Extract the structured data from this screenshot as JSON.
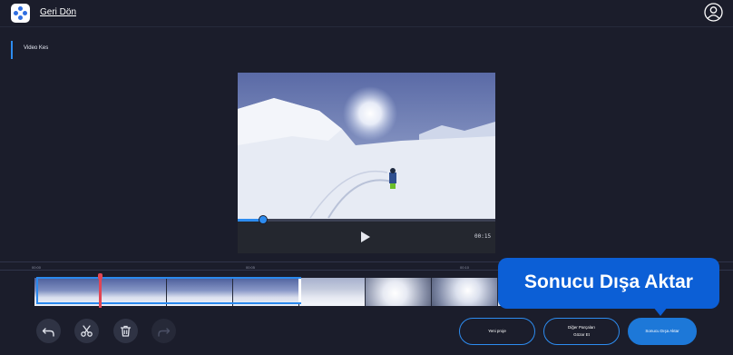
{
  "header": {
    "logo_icon": "app-logo-icon",
    "back_label": "Geri Dön",
    "account_icon": "user-account-icon"
  },
  "section": {
    "title": "Video Kes"
  },
  "player": {
    "time": "00:15",
    "progress": 0.1,
    "play_icon": "play-icon"
  },
  "timeline": {
    "ticks": [
      "00:00",
      "00:05",
      "00:10"
    ],
    "selection_color": "#2a89ee",
    "playhead_color": "#e24554"
  },
  "toolbar": {
    "undo_icon": "undo-icon",
    "cut_icon": "scissors-icon",
    "delete_icon": "trash-icon",
    "redo_icon": "redo-icon"
  },
  "actions": {
    "new_project": "Yeni proje",
    "ignore_line1": "Diğer Parçaları",
    "ignore_line2": "Gözar Et",
    "export": "Sonucu Dışa Aktar"
  },
  "tooltip": {
    "text": "Sonucu Dışa Aktar"
  },
  "colors": {
    "accent": "#2d8cf0",
    "background": "#1b1d2b",
    "tooltip": "#0c5fd6"
  }
}
